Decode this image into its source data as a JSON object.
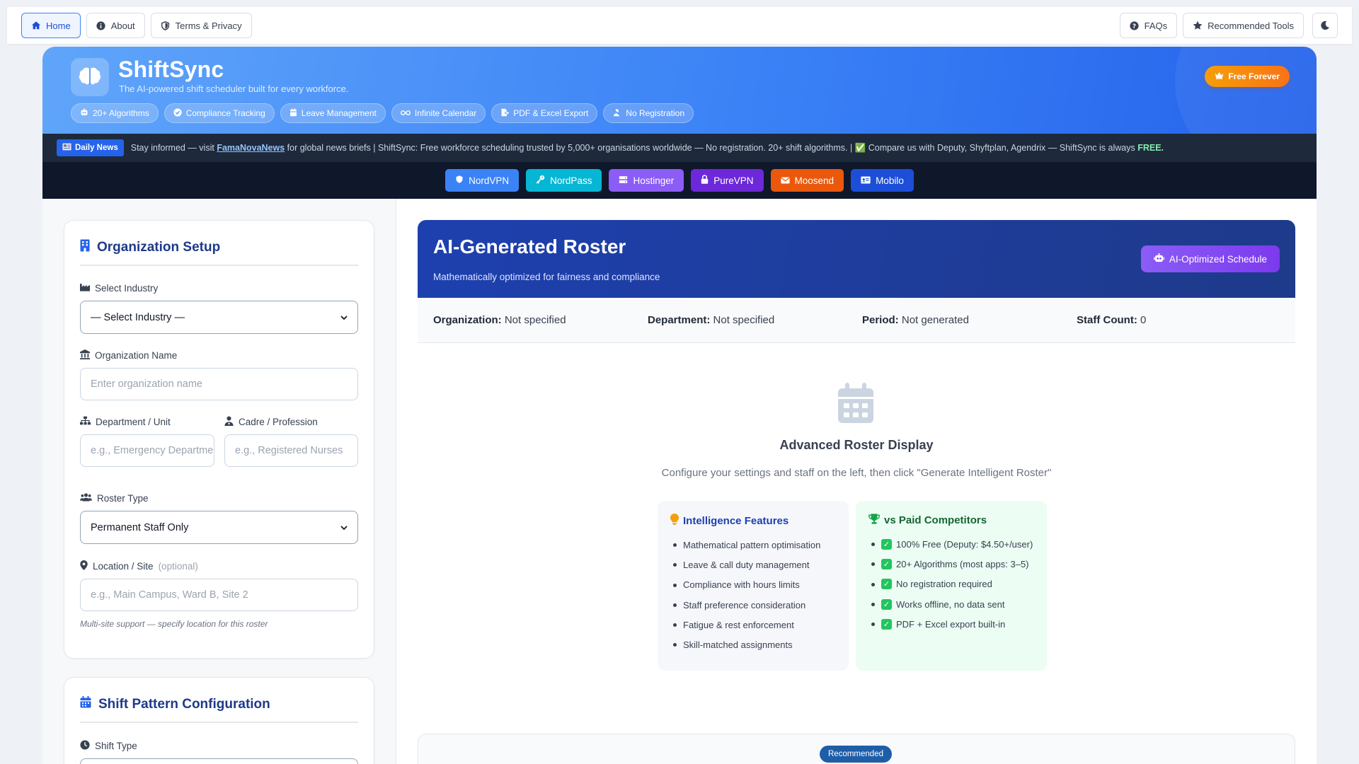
{
  "nav": {
    "left": [
      {
        "label": "Home",
        "icon": "home-icon",
        "active": true
      },
      {
        "label": "About",
        "icon": "info-icon"
      },
      {
        "label": "Terms & Privacy",
        "icon": "shield-icon"
      }
    ],
    "right": [
      {
        "label": "FAQs",
        "icon": "question-icon"
      },
      {
        "label": "Recommended Tools",
        "icon": "star-icon"
      }
    ],
    "theme_icon": "moon-icon"
  },
  "hero": {
    "brand": "ShiftSync",
    "tagline": "The AI-powered shift scheduler built for every workforce.",
    "badge": "Free Forever",
    "chips": [
      {
        "label": "20+ Algorithms",
        "icon": "robot-icon"
      },
      {
        "label": "Compliance Tracking",
        "icon": "check-circle-icon"
      },
      {
        "label": "Leave Management",
        "icon": "calendar-icon"
      },
      {
        "label": "Infinite Calendar",
        "icon": "infinity-icon"
      },
      {
        "label": "PDF & Excel Export",
        "icon": "file-export-icon"
      },
      {
        "label": "No Registration",
        "icon": "user-slash-icon"
      }
    ]
  },
  "news": {
    "tag": "Daily News",
    "pre": "Stay informed — visit ",
    "link": "FamaNovaNews",
    "mid": " for global news briefs  |  ShiftSync: Free workforce scheduling trusted by 5,000+ organisations worldwide — No registration. 20+ shift algorithms.  |  ✅ Compare us with Deputy, Shyftplan, Agendrix — ShiftSync is always ",
    "end": "FREE."
  },
  "partners": [
    {
      "label": "NordVPN",
      "icon": "shield-icon",
      "color": "#3b82f6"
    },
    {
      "label": "NordPass",
      "icon": "key-icon",
      "color": "#06b6d4"
    },
    {
      "label": "Hostinger",
      "icon": "server-icon",
      "color": "#8b5cf6"
    },
    {
      "label": "PureVPN",
      "icon": "lock-icon",
      "color": "#6d28d9"
    },
    {
      "label": "Moosend",
      "icon": "envelope-icon",
      "color": "#ea580c"
    },
    {
      "label": "Mobilo",
      "icon": "id-card-icon",
      "color": "#1d4ed8"
    }
  ],
  "org": {
    "title": "Organization Setup",
    "industry_label": "Select Industry",
    "industry_value": "— Select Industry —",
    "name_label": "Organization Name",
    "name_placeholder": "Enter organization name",
    "dept_label": "Department / Unit",
    "dept_placeholder": "e.g., Emergency Department",
    "cadre_label": "Cadre / Profession",
    "cadre_placeholder": "e.g., Registered Nurses",
    "roster_label": "Roster Type",
    "roster_value": "Permanent Staff Only",
    "location_label": "Location / Site",
    "location_optional": "(optional)",
    "location_placeholder": "e.g., Main Campus, Ward B, Site 2",
    "location_hint": "Multi-site support — specify location for this roster"
  },
  "shift": {
    "title": "Shift Pattern Configuration",
    "type_label": "Shift Type"
  },
  "roster": {
    "title": "AI-Generated Roster",
    "subtitle": "Mathematically optimized for fairness and compliance",
    "badge": "AI-Optimized Schedule",
    "meta": [
      {
        "key": "Organization:",
        "value": "Not specified"
      },
      {
        "key": "Department:",
        "value": "Not specified"
      },
      {
        "key": "Period:",
        "value": "Not generated"
      },
      {
        "key": "Staff Count:",
        "value": "0"
      }
    ],
    "empty_title": "Advanced Roster Display",
    "empty_sub": "Configure your settings and staff on the left, then click \"Generate Intelligent Roster\"",
    "features": {
      "title": "Intelligence Features",
      "items": [
        "Mathematical pattern optimisation",
        "Leave & call duty management",
        "Compliance with hours limits",
        "Staff preference consideration",
        "Fatigue & rest enforcement",
        "Skill-matched assignments"
      ]
    },
    "competitors": {
      "title": "vs Paid Competitors",
      "items": [
        "100% Free (Deputy: $4.50+/user)",
        "20+ Algorithms (most apps: 3–5)",
        "No registration required",
        "Works offline, no data sent",
        "PDF + Excel export built-in"
      ]
    },
    "recommended": "Recommended"
  }
}
